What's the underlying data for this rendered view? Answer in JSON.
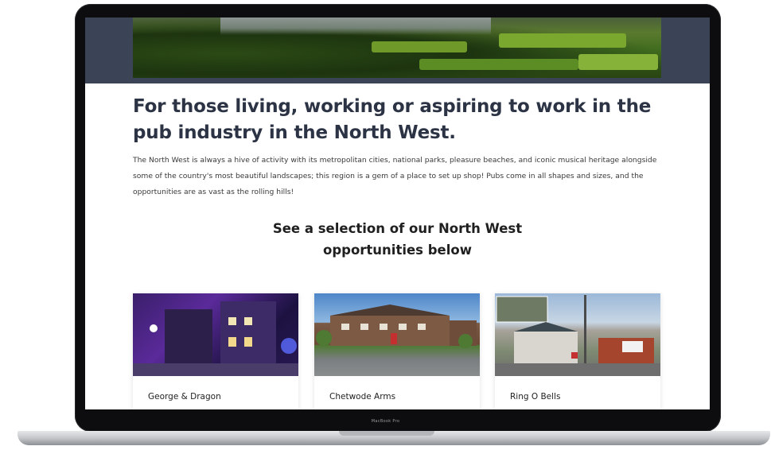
{
  "device": {
    "bezel_label": "MacBook Pro"
  },
  "page": {
    "headline": "For those living, working or aspiring to work in the pub industry in the North West.",
    "intro": "The North West is always a hive of activity with its metropolitan cities, national parks, pleasure beaches, and iconic musical heritage alongside some of the country's most beautiful landscapes; this region is a gem of a place to set up shop! Pubs come in all shapes and sizes, and the opportunities are as vast as the rolling hills!",
    "subhead": "See a selection of our North West opportunities below",
    "cards": [
      {
        "title": "George & Dragon"
      },
      {
        "title": "Chetwode Arms"
      },
      {
        "title": "Ring O Bells"
      }
    ]
  },
  "colors": {
    "header_band": "#3b4456",
    "headline": "#2b3344"
  }
}
